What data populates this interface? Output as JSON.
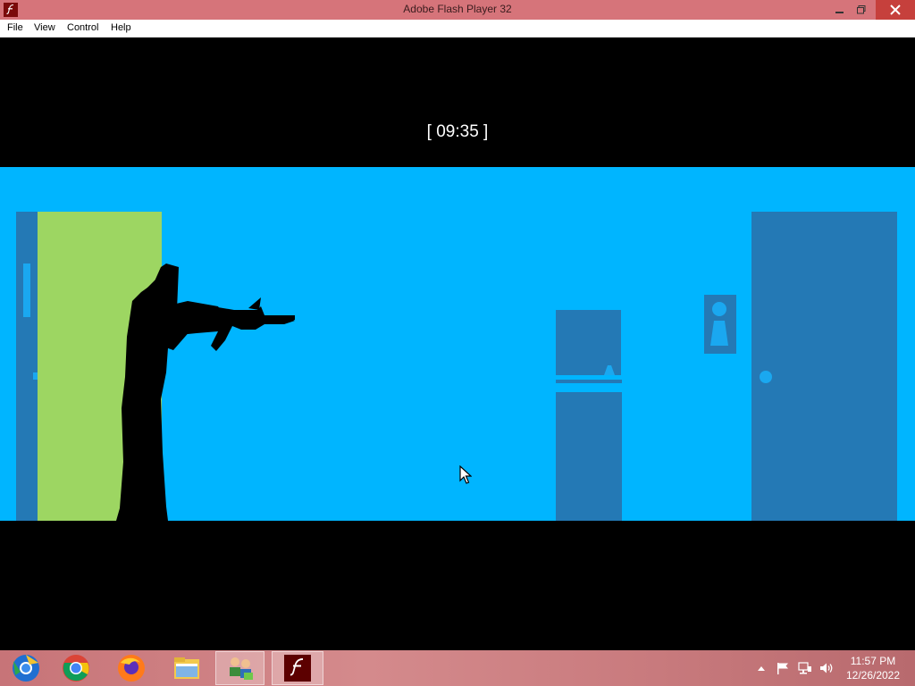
{
  "window": {
    "title": "Adobe Flash Player 32",
    "menu": [
      "File",
      "View",
      "Control",
      "Help"
    ]
  },
  "game": {
    "timer": "[ 09:35 ]",
    "colors": {
      "sky": "#00b5ff",
      "wall_dark": "#2479b5",
      "door_green": "#9dd662",
      "silhouette": "#000000",
      "letterbox": "#000000"
    }
  },
  "taskbar": {
    "apps": [
      {
        "name": "chromium-icon",
        "active": false
      },
      {
        "name": "chrome-icon",
        "active": false
      },
      {
        "name": "firefox-icon",
        "active": false
      },
      {
        "name": "file-explorer-icon",
        "active": false
      },
      {
        "name": "network-users-icon",
        "active": false
      },
      {
        "name": "flash-player-icon",
        "active": true
      }
    ],
    "tray_icons": [
      "chevron-up-icon",
      "flag-icon",
      "network-icon",
      "volume-icon"
    ],
    "clock": {
      "time": "11:57 PM",
      "date": "12/26/2022"
    }
  }
}
